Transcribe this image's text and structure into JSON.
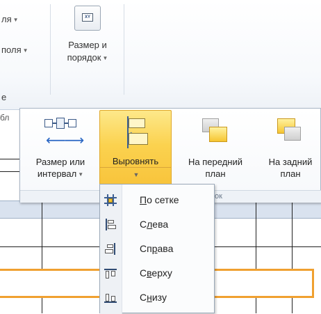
{
  "ribbon": {
    "left_item_1": "ля",
    "left_item_2": "поля",
    "left_item_3": "е",
    "size_order_icon_text": "XY",
    "size_order_label_1": "Размер и",
    "size_order_label_2": "порядок",
    "left_edge_text": "бл"
  },
  "gallery": {
    "buttons": [
      {
        "label_1": "Размер или",
        "label_2": "интервал",
        "has_arrow": true
      },
      {
        "label_1": "Выровнять",
        "label_2": "",
        "has_arrow": true,
        "active": true
      },
      {
        "label_1": "На передний",
        "label_2": "план"
      },
      {
        "label_1": "На задний",
        "label_2": "план"
      }
    ],
    "group_label_fragment": "ок"
  },
  "align_menu": {
    "items": [
      {
        "pre": "",
        "mnemonic": "П",
        "post": "о сетке",
        "icon": "snap-to-grid-icon"
      },
      {
        "pre": "С",
        "mnemonic": "л",
        "post": "ева",
        "icon": "align-left-icon"
      },
      {
        "pre": "Сп",
        "mnemonic": "р",
        "post": "ава",
        "icon": "align-right-icon"
      },
      {
        "pre": "С",
        "mnemonic": "в",
        "post": "ерху",
        "icon": "align-top-icon"
      },
      {
        "pre": "С",
        "mnemonic": "н",
        "post": "изу",
        "icon": "align-bottom-icon"
      }
    ]
  },
  "colors": {
    "active_highlight": "#f8c33a",
    "selection_outline": "#f0a030",
    "accent_blue": "#2a66c4"
  }
}
